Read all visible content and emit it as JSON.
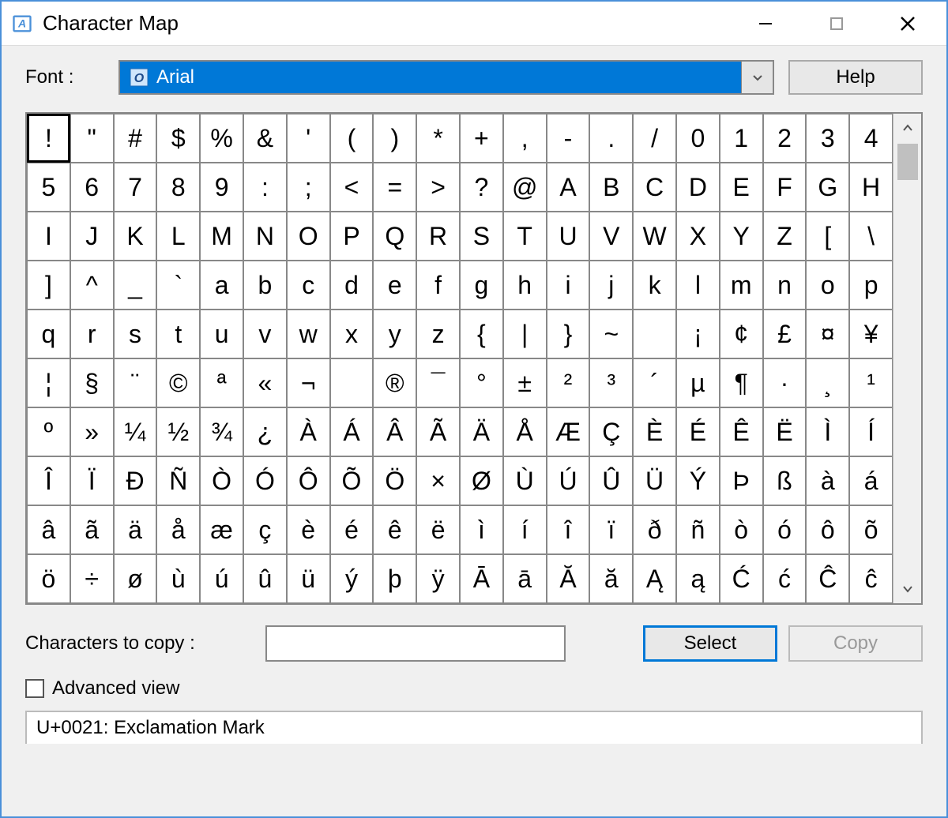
{
  "window": {
    "title": "Character Map"
  },
  "font": {
    "label": "Font :",
    "selected": "Arial"
  },
  "buttons": {
    "help": "Help",
    "select": "Select",
    "copy": "Copy"
  },
  "copy_section": {
    "label": "Characters to copy :",
    "value": ""
  },
  "advanced": {
    "label": "Advanced view",
    "checked": false
  },
  "status": "U+0021: Exclamation Mark",
  "selected_index": 0,
  "characters": [
    "!",
    "\"",
    "#",
    "$",
    "%",
    "&",
    "'",
    "(",
    ")",
    "*",
    "+",
    ",",
    "-",
    ".",
    "/",
    "0",
    "1",
    "2",
    "3",
    "4",
    "5",
    "6",
    "7",
    "8",
    "9",
    ":",
    ";",
    "<",
    "=",
    ">",
    "?",
    "@",
    "A",
    "B",
    "C",
    "D",
    "E",
    "F",
    "G",
    "H",
    "I",
    "J",
    "K",
    "L",
    "M",
    "N",
    "O",
    "P",
    "Q",
    "R",
    "S",
    "T",
    "U",
    "V",
    "W",
    "X",
    "Y",
    "Z",
    "[",
    "\\",
    "]",
    "^",
    "_",
    "`",
    "a",
    "b",
    "c",
    "d",
    "e",
    "f",
    "g",
    "h",
    "i",
    "j",
    "k",
    "l",
    "m",
    "n",
    "o",
    "p",
    "q",
    "r",
    "s",
    "t",
    "u",
    "v",
    "w",
    "x",
    "y",
    "z",
    "{",
    "|",
    "}",
    "~",
    " ",
    "¡",
    "¢",
    "£",
    "¤",
    "¥",
    "¦",
    "§",
    "¨",
    "©",
    "ª",
    "«",
    "¬",
    "­",
    "®",
    "¯",
    "°",
    "±",
    "²",
    "³",
    "´",
    "µ",
    "¶",
    "·",
    "¸",
    "¹",
    "º",
    "»",
    "¼",
    "½",
    "¾",
    "¿",
    "À",
    "Á",
    "Â",
    "Ã",
    "Ä",
    "Å",
    "Æ",
    "Ç",
    "È",
    "É",
    "Ê",
    "Ë",
    "Ì",
    "Í",
    "Î",
    "Ï",
    "Ð",
    "Ñ",
    "Ò",
    "Ó",
    "Ô",
    "Õ",
    "Ö",
    "×",
    "Ø",
    "Ù",
    "Ú",
    "Û",
    "Ü",
    "Ý",
    "Þ",
    "ß",
    "à",
    "á",
    "â",
    "ã",
    "ä",
    "å",
    "æ",
    "ç",
    "è",
    "é",
    "ê",
    "ë",
    "ì",
    "í",
    "î",
    "ï",
    "ð",
    "ñ",
    "ò",
    "ó",
    "ô",
    "õ",
    "ö",
    "÷",
    "ø",
    "ù",
    "ú",
    "û",
    "ü",
    "ý",
    "þ",
    "ÿ",
    "Ā",
    "ā",
    "Ă",
    "ă",
    "Ą",
    "ą",
    "Ć",
    "ć",
    "Ĉ",
    "ĉ"
  ]
}
